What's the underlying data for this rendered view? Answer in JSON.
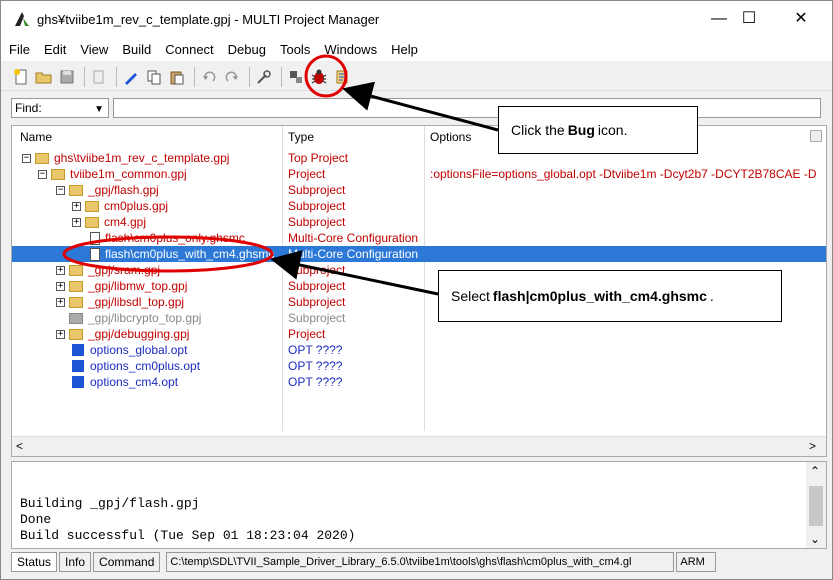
{
  "window": {
    "title": "ghs¥tviibe1m_rev_c_template.gpj - MULTI Project Manager",
    "minimize": "—",
    "maximize": "☐",
    "close": "✕"
  },
  "menu": [
    "File",
    "Edit",
    "View",
    "Build",
    "Connect",
    "Debug",
    "Tools",
    "Windows",
    "Help"
  ],
  "toolbar": {
    "icons": [
      "new-file-icon",
      "open-folder-icon",
      "save-icon",
      "copy-disabled-icon",
      "edit-icon",
      "copy-icon",
      "paste-icon",
      "undo-icon",
      "redo-icon",
      "build-tools-icon",
      "flash-icon",
      "bug-icon",
      "settings-icon"
    ]
  },
  "find": {
    "label": "Find:",
    "value": ""
  },
  "tree": {
    "columns": {
      "name": "Name",
      "type": "Type",
      "options": "Options"
    },
    "rows": [
      {
        "name": "ghs\\tviibe1m_rev_c_template.gpj",
        "type": "Top Project",
        "options": ""
      },
      {
        "name": "tviibe1m_common.gpj",
        "type": "Project",
        "options": ":optionsFile=options_global.opt -Dtviibe1m -Dcyt2b7 -DCYT2B78CAE -D"
      },
      {
        "name": "_gpj/flash.gpj",
        "type": "Subproject",
        "options": ""
      },
      {
        "name": "cm0plus.gpj",
        "type": "Subproject",
        "options": ""
      },
      {
        "name": "cm4.gpj",
        "type": "Subproject",
        "options": ""
      },
      {
        "name": "flash\\cm0plus_only.ghsmc",
        "type": "Multi-Core Configuration",
        "options": ""
      },
      {
        "name": "flash\\cm0plus_with_cm4.ghsmc",
        "type": "Multi-Core Configuration",
        "options": ""
      },
      {
        "name": "_gpj/sram.gpj",
        "type": "Subproject",
        "options": ""
      },
      {
        "name": "_gpj/libmw_top.gpj",
        "type": "Subproject",
        "options": ""
      },
      {
        "name": "_gpj/libsdl_top.gpj",
        "type": "Subproject",
        "options": ""
      },
      {
        "name": "_gpj/libcrypto_top.gpj",
        "type": "Subproject",
        "options": ""
      },
      {
        "name": "_gpj/debugging.gpj",
        "type": "Project",
        "options": ""
      },
      {
        "name": "options_global.opt",
        "type": "OPT ????",
        "options": ""
      },
      {
        "name": "options_cm0plus.opt",
        "type": "OPT ????",
        "options": ""
      },
      {
        "name": "options_cm4.opt",
        "type": "OPT ????",
        "options": ""
      }
    ]
  },
  "output": {
    "lines": [
      "Building _gpj/flash.gpj",
      "Done",
      "Build successful (Tue Sep 01 18:23:04 2020)"
    ]
  },
  "status": {
    "tabs": [
      "Status",
      "Info",
      "Command"
    ],
    "path": "C:\\temp\\SDL\\TVII_Sample_Driver_Library_6.5.0\\tviibe1m\\tools\\ghs\\flash\\cm0plus_with_cm4.gl",
    "arch": "ARM"
  },
  "callouts": {
    "bug": {
      "prefix": "Click the",
      "bold": "Bug",
      "suffix": "icon."
    },
    "select": {
      "prefix": "Select",
      "bold": "flash|cm0plus_with_cm4.ghsmc",
      "suffix": "."
    }
  },
  "colors": {
    "selection": "#2b78d7",
    "annotation": "#e00000",
    "red_text": "#c00000",
    "blue_text": "#1a2bc0"
  }
}
